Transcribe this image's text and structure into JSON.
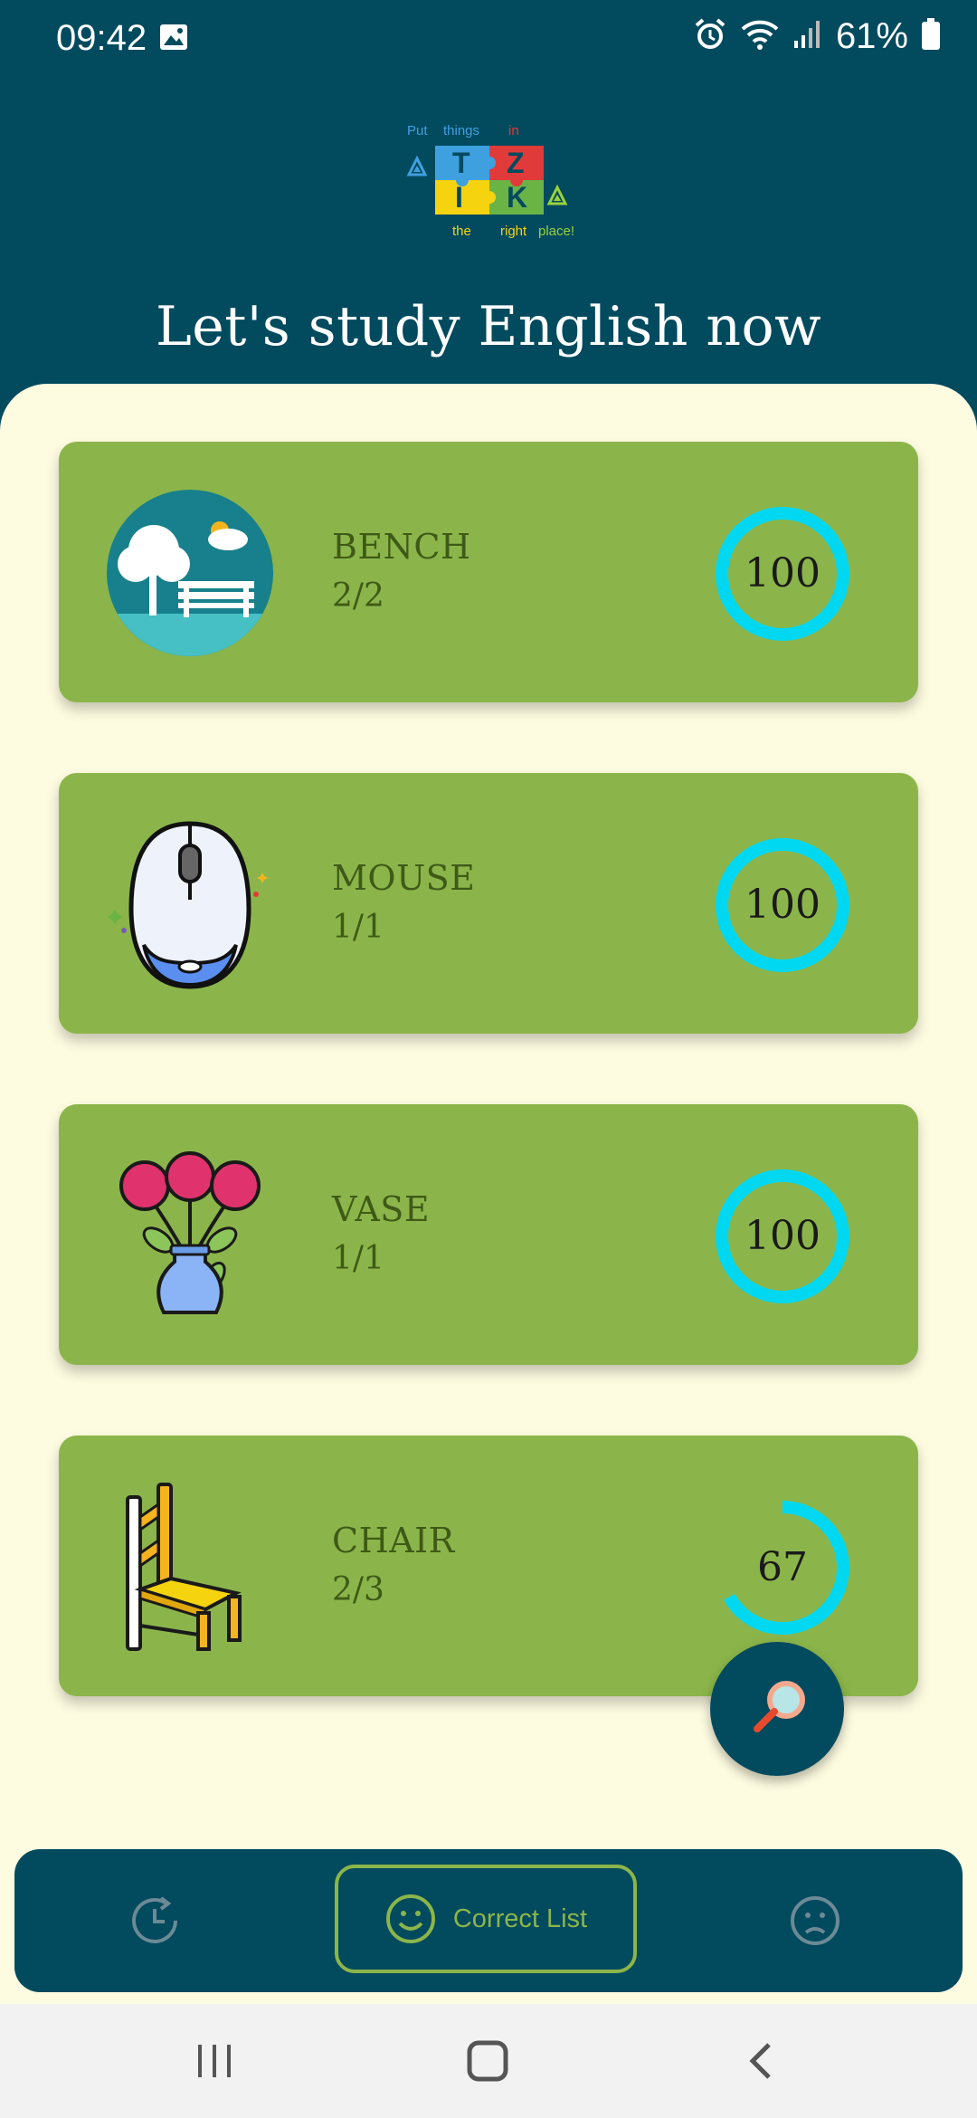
{
  "status_bar": {
    "time": "09:42",
    "battery": "61%"
  },
  "logo": {
    "top_words": [
      "Put",
      "things",
      "in"
    ],
    "bottom_words": [
      "the",
      "right",
      "place!"
    ],
    "letters": [
      "T",
      "Z",
      "I",
      "K"
    ]
  },
  "header": {
    "title": "Let's study English now"
  },
  "cards": [
    {
      "title": "BENCH",
      "count": "2/2",
      "score": "100",
      "progress": 1.0
    },
    {
      "title": "MOUSE",
      "count": "1/1",
      "score": "100",
      "progress": 1.0
    },
    {
      "title": "VASE",
      "count": "1/1",
      "score": "100",
      "progress": 1.0
    },
    {
      "title": "CHAIR",
      "count": "2/3",
      "score": "67",
      "progress": 0.67
    }
  ],
  "bottom_nav": {
    "active_label": "Correct List",
    "items": [
      "history-icon",
      "happy-face-icon",
      "sad-face-icon"
    ]
  },
  "colors": {
    "primary": "#024a5e",
    "card": "#8bb54a",
    "ring": "#00d8f2",
    "background": "#fdfbe0"
  }
}
